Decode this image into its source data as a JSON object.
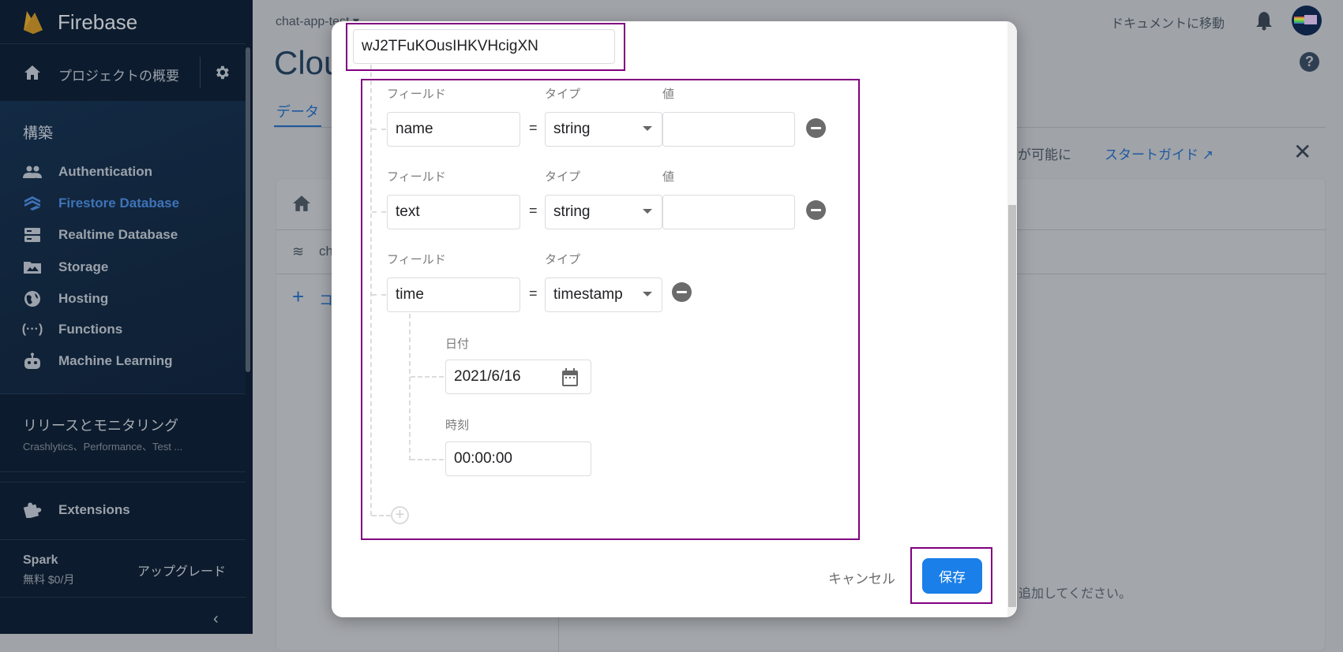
{
  "sidebar": {
    "brand": "Firebase",
    "overview": "プロジェクトの概要",
    "section_build": "構築",
    "items": [
      {
        "label": "Authentication",
        "icon": "people-icon"
      },
      {
        "label": "Firestore Database",
        "icon": "firestore-icon",
        "active": true
      },
      {
        "label": "Realtime Database",
        "icon": "database-icon"
      },
      {
        "label": "Storage",
        "icon": "folder-image-icon"
      },
      {
        "label": "Hosting",
        "icon": "globe-icon"
      },
      {
        "label": "Functions",
        "icon": "functions-icon"
      },
      {
        "label": "Machine Learning",
        "icon": "robot-icon"
      }
    ],
    "release_title": "リリースとモニタリング",
    "release_sub": "Crashlytics、Performance、Test ...",
    "extensions": "Extensions",
    "plan_name": "Spark",
    "plan_price": "無料 $0/月",
    "upgrade": "アップグレード"
  },
  "header": {
    "project": "chat-app-test",
    "title": "Cloud Firestore",
    "docs_link": "ドキュメントに移動"
  },
  "tabs": [
    {
      "label": "データ",
      "active": true
    }
  ],
  "banner": {
    "text": "が可能に",
    "guide": "スタートガイド"
  },
  "panel": {
    "collection_prefix": "ch",
    "add_prefix": "コ",
    "empty_hint": "追加してください。"
  },
  "dialog": {
    "document_id": "wJ2TFuKOusIHKVHcigXN",
    "labels": {
      "field": "フィールド",
      "type": "タイプ",
      "value": "値",
      "date": "日付",
      "time": "時刻"
    },
    "fields": [
      {
        "name": "name",
        "type": "string",
        "value": ""
      },
      {
        "name": "text",
        "type": "string",
        "value": ""
      },
      {
        "name": "time",
        "type": "timestamp",
        "date": "2021/6/16",
        "time": "00:00:00"
      }
    ],
    "equals": "=",
    "cancel": "キャンセル",
    "save": "保存"
  },
  "colors": {
    "accent": "#1a7fe8",
    "highlight": "#800080",
    "sidebar_active": "#3f73b8"
  }
}
